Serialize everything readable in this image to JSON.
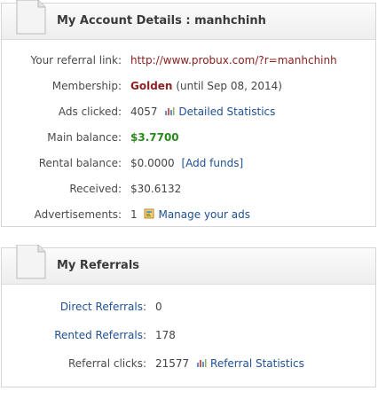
{
  "account": {
    "title": "My Account Details : manhchinh",
    "referral_link_label": "Your referral link:",
    "referral_link": "http://www.probux.com/?r=manhchinh",
    "membership_label": "Membership:",
    "membership_level": "Golden",
    "membership_until": "(until Sep 08, 2014)",
    "ads_clicked_label": "Ads clicked:",
    "ads_clicked": "4057",
    "detailed_stats_link": "Detailed Statistics",
    "main_balance_label": "Main balance:",
    "main_balance": "$3.7700",
    "rental_balance_label": "Rental balance:",
    "rental_balance": "$0.0000",
    "add_funds_link": "[Add funds]",
    "received_label": "Received:",
    "received": "$30.6132",
    "advertisements_label": "Advertisements:",
    "advertisements": "1",
    "manage_ads_link": "Manage your ads"
  },
  "referrals": {
    "title": "My Referrals",
    "direct_label": "Direct Referrals",
    "direct_colon": ":",
    "direct_count": "0",
    "rented_label": "Rented Referrals",
    "rented_colon": ":",
    "rented_count": "178",
    "clicks_label": "Referral clicks:",
    "clicks_count": "21577",
    "stats_link": "Referral Statistics"
  },
  "icons": {
    "document": "document-icon",
    "chart": "bar-chart-icon",
    "ads": "ads-icon"
  },
  "colors": {
    "link": "#1f4f94",
    "golden": "#8b2222",
    "balance": "#2a8a1e"
  }
}
